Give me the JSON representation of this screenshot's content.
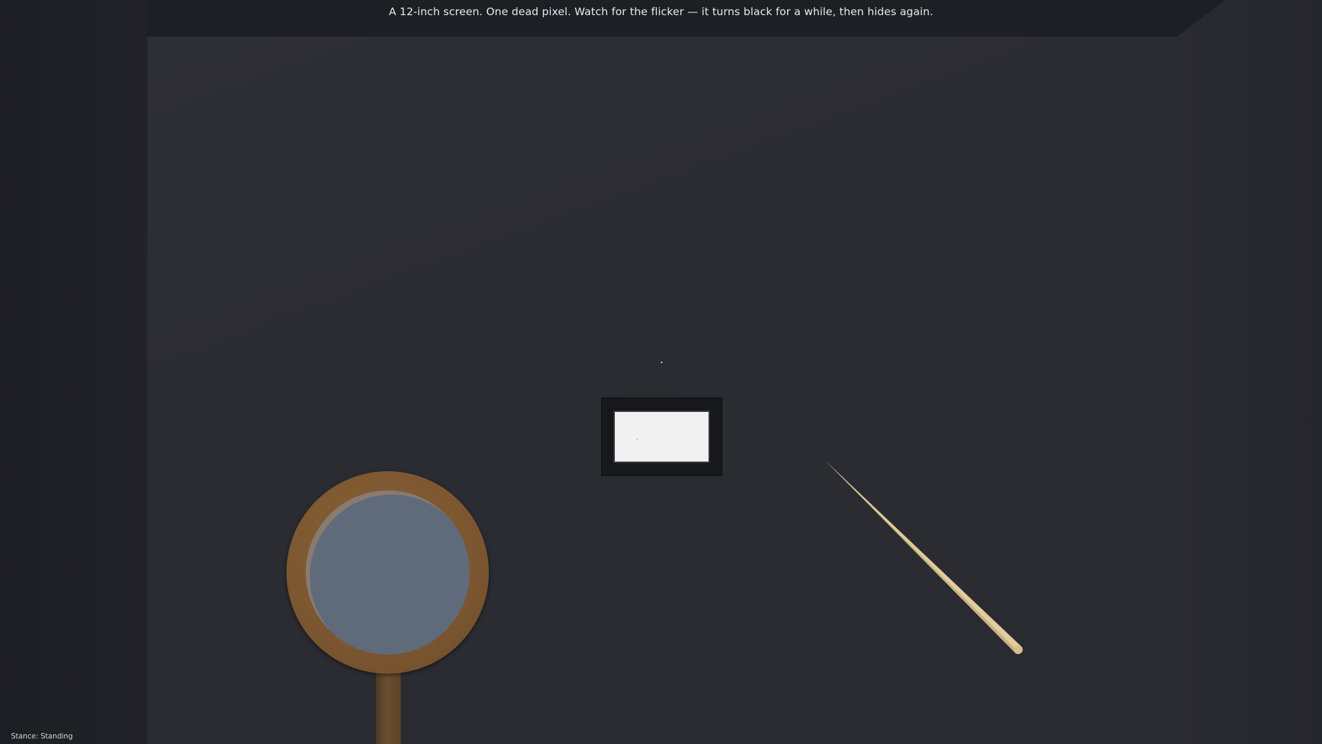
{
  "header": {
    "instruction": "A 12-inch screen. One dead pixel. Watch for the flicker — it turns black for a while, then hides again."
  },
  "hud": {
    "stance": "Stance: Standing"
  },
  "scene": {
    "items": [
      {
        "name": "monitor",
        "icon": "monitor-icon"
      },
      {
        "name": "magnifying-glass",
        "icon": "magnifier-icon"
      },
      {
        "name": "wooden-pointer-stick",
        "icon": "stick-icon"
      }
    ],
    "colors": {
      "back_wall": "#2b2c32",
      "screen": "#f1f1f1",
      "magnifier_rim": "#7b5630",
      "magnifier_glass": "#5f6b7b",
      "stick": "#e3cc9e"
    }
  }
}
